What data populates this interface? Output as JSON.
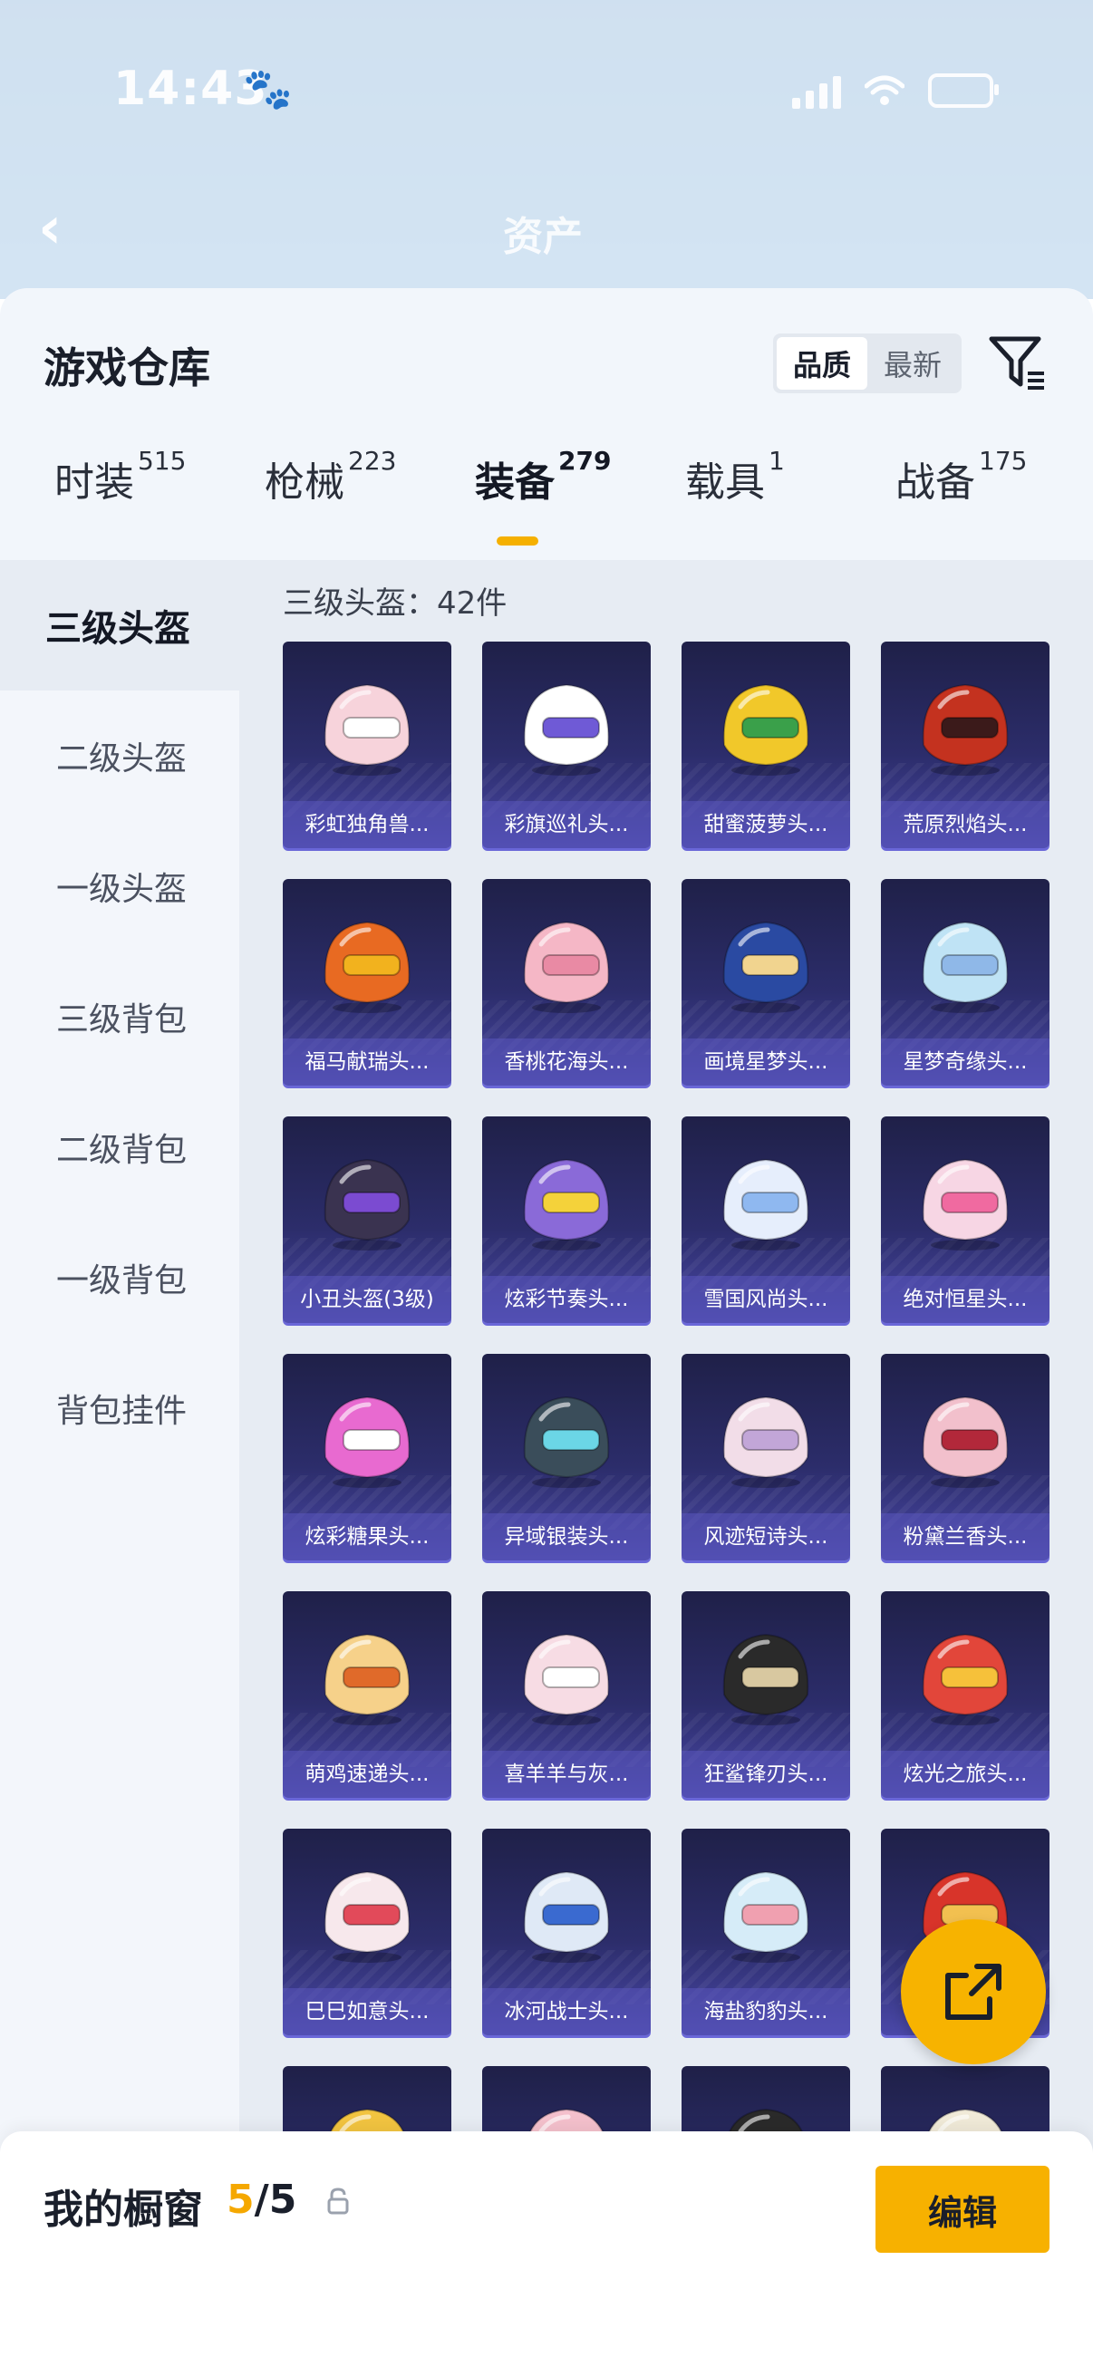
{
  "status_bar": {
    "time": "14:43",
    "paw": "🐾"
  },
  "nav": {
    "back_glyph": "‹",
    "title": "资产"
  },
  "sheet": {
    "title": "游戏仓库",
    "sort": {
      "options": [
        "品质",
        "最新"
      ],
      "active": "品质"
    }
  },
  "tabs": [
    {
      "label": "时装",
      "count": "515"
    },
    {
      "label": "枪械",
      "count": "223"
    },
    {
      "label": "装备",
      "count": "279",
      "active": true
    },
    {
      "label": "载具",
      "count": "1"
    },
    {
      "label": "战备",
      "count": "175"
    }
  ],
  "sidebar": {
    "items": [
      {
        "label": "三级头盔",
        "active": true
      },
      {
        "label": "二级头盔"
      },
      {
        "label": "一级头盔"
      },
      {
        "label": "三级背包"
      },
      {
        "label": "二级背包"
      },
      {
        "label": "一级背包"
      },
      {
        "label": "背包挂件"
      }
    ]
  },
  "grid": {
    "title": "三级头盔：42件",
    "items": [
      {
        "name": "彩虹独角兽...",
        "c1": "#f7d3db",
        "c2": "#ffffff"
      },
      {
        "name": "彩旗巡礼头...",
        "c1": "#ffffff",
        "c2": "#6f5ad6"
      },
      {
        "name": "甜蜜菠萝头...",
        "c1": "#f1c82a",
        "c2": "#3aa04a"
      },
      {
        "name": "荒原烈焰头...",
        "c1": "#c4321f",
        "c2": "#3b1a1a"
      },
      {
        "name": "福马献瑞头...",
        "c1": "#e86a22",
        "c2": "#f2b21e"
      },
      {
        "name": "香桃花海头...",
        "c1": "#f5b7c6",
        "c2": "#e98aa4"
      },
      {
        "name": "画境星梦头...",
        "c1": "#2a4aa2",
        "c2": "#f1d48f"
      },
      {
        "name": "星梦奇缘头...",
        "c1": "#bfe3f5",
        "c2": "#8fb8e8"
      },
      {
        "name": "小丑头盔(3级)",
        "c1": "#3a3350",
        "c2": "#7b4bd1"
      },
      {
        "name": "炫彩节奏头...",
        "c1": "#8a6ad8",
        "c2": "#f4d23a"
      },
      {
        "name": "雪国风尚头...",
        "c1": "#e6eefc",
        "c2": "#8fb8f0"
      },
      {
        "name": "绝对恒星头...",
        "c1": "#f7d6e4",
        "c2": "#f06aa0"
      },
      {
        "name": "炫彩糖果头...",
        "c1": "#e86ad0",
        "c2": "#ffffff"
      },
      {
        "name": "异域银装头...",
        "c1": "#3a4d5a",
        "c2": "#6bd6e6"
      },
      {
        "name": "风迹短诗头...",
        "c1": "#f2dde8",
        "c2": "#c2a6d8"
      },
      {
        "name": "粉黛兰香头...",
        "c1": "#f2c0cc",
        "c2": "#b2283a"
      },
      {
        "name": "萌鸡速递头...",
        "c1": "#f6d18a",
        "c2": "#e06a2a"
      },
      {
        "name": "喜羊羊与灰...",
        "c1": "#f7dce4",
        "c2": "#ffffff"
      },
      {
        "name": "狂鲨锋刃头...",
        "c1": "#2a2a2a",
        "c2": "#d8c8a0"
      },
      {
        "name": "炫光之旅头...",
        "c1": "#e2463a",
        "c2": "#f6c13a"
      },
      {
        "name": "巳巳如意头...",
        "c1": "#f7e8ec",
        "c2": "#e24a5a"
      },
      {
        "name": "冰河战士头...",
        "c1": "#dfe9f6",
        "c2": "#3a6ad0"
      },
      {
        "name": "海盐豹豹头...",
        "c1": "#d6ecf8",
        "c2": "#f0a0b0"
      },
      {
        "name": "",
        "c1": "#d8342a",
        "c2": "#f2c050"
      },
      {
        "name": "",
        "c1": "#f2c440",
        "c2": "#ffffff"
      },
      {
        "name": "",
        "c1": "#f4c0cc",
        "c2": "#ffffff"
      },
      {
        "name": "",
        "c1": "#2a2a2a",
        "c2": "#c8a050"
      },
      {
        "name": "",
        "c1": "#f0ead8",
        "c2": "#3aa04a"
      }
    ]
  },
  "bottom_bar": {
    "label": "我的橱窗",
    "count_current": "5",
    "count_total": "/5",
    "edit_label": "编辑"
  },
  "colors": {
    "accent": "#f7b100",
    "card_top": "#1f2048",
    "card_bottom": "#4a48a8",
    "sheet_bg": "#f2f6fb"
  },
  "icons": [
    "back-arrow-icon",
    "filter-icon",
    "lock-icon",
    "share-export-icon",
    "wifi-icon",
    "signal-icon",
    "battery-icon"
  ]
}
